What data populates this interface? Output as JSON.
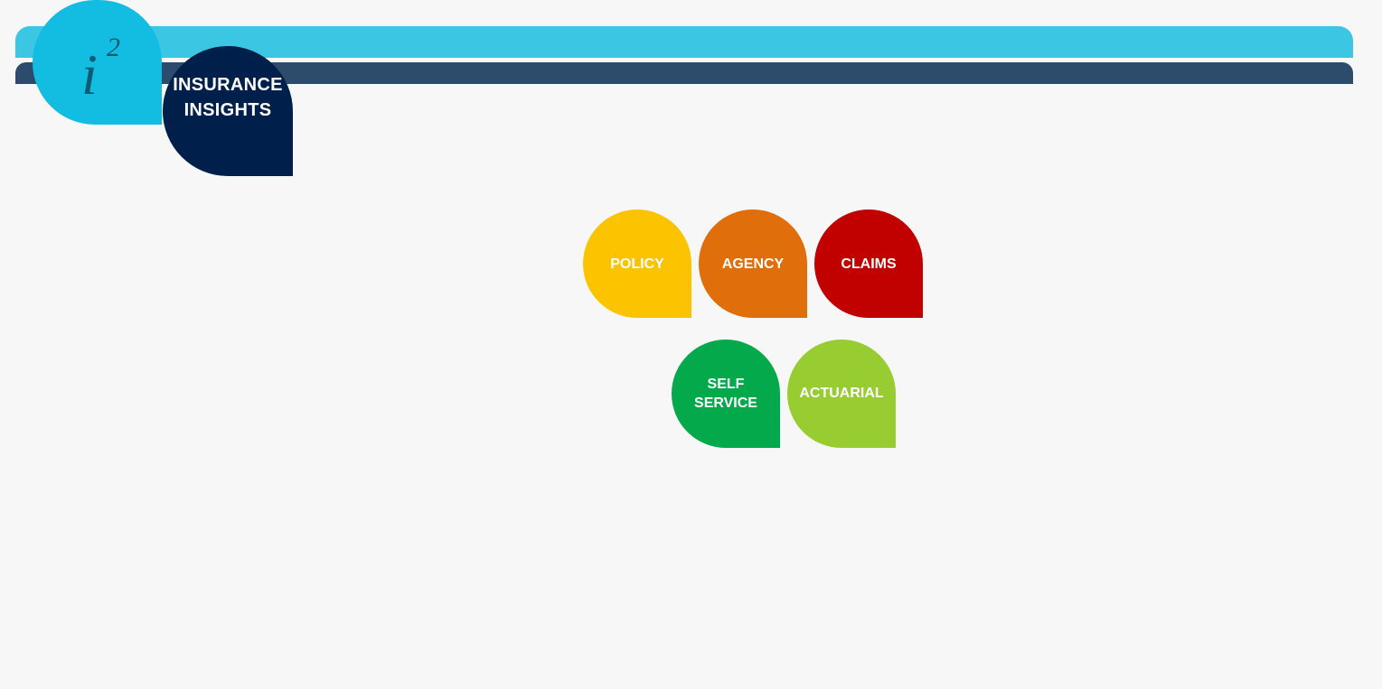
{
  "header": {
    "app_title": "INSURANCE\nINSIGHTS",
    "logo_icon": "i-squared-logo-icon",
    "colors": {
      "bar_top": "#3bc7e3",
      "bar_bottom": "#2d4b6c",
      "logo_bg": "#13bde2",
      "title_bg": "#00204b"
    }
  },
  "tiles": [
    {
      "label": "POLICY",
      "color": "#fcc300"
    },
    {
      "label": "AGENCY",
      "color": "#e06e0b"
    },
    {
      "label": "CLAIMS",
      "color": "#c10000"
    },
    {
      "label": "SELF\nSERVICE",
      "color": "#04a94c"
    },
    {
      "label": "ACTUARIAL",
      "color": "#97cd30"
    }
  ]
}
